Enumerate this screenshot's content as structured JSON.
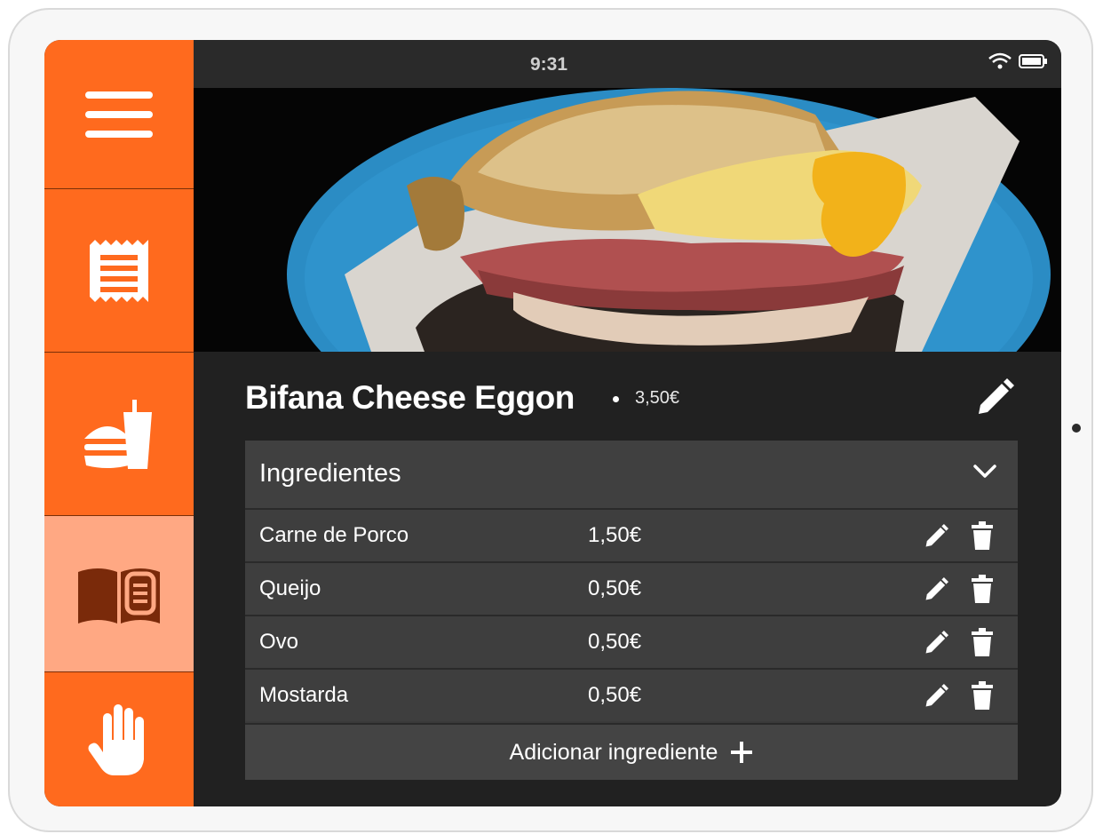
{
  "status_bar": {
    "time": "9:31",
    "icons": [
      "wifi-icon",
      "battery-icon"
    ]
  },
  "sidebar": {
    "items": [
      {
        "name": "menu",
        "icon": "hamburger-icon",
        "active": false
      },
      {
        "name": "orders",
        "icon": "receipt-icon",
        "active": false
      },
      {
        "name": "food",
        "icon": "burger-drink-icon",
        "active": false
      },
      {
        "name": "menu-book",
        "icon": "open-book-icon",
        "active": true
      },
      {
        "name": "help",
        "icon": "hand-icon",
        "active": false
      }
    ]
  },
  "product": {
    "name": "Bifana Cheese Eggon",
    "price": "3,50€",
    "edit_icon": "pencil-icon"
  },
  "ingredients": {
    "header": "Ingredientes",
    "toggle_icon": "chevron-down-icon",
    "items": [
      {
        "name": "Carne de Porco",
        "price": "1,50€"
      },
      {
        "name": "Queijo",
        "price": "0,50€"
      },
      {
        "name": "Ovo",
        "price": "0,50€"
      },
      {
        "name": "Mostarda",
        "price": "0,50€"
      }
    ],
    "add_label": "Adicionar ingrediente",
    "add_icon": "plus-icon"
  },
  "colors": {
    "sidebar": "#ff6a1e",
    "sidebar_active": "#ffa883",
    "background": "#212121",
    "panel": "#3a3a3a"
  }
}
